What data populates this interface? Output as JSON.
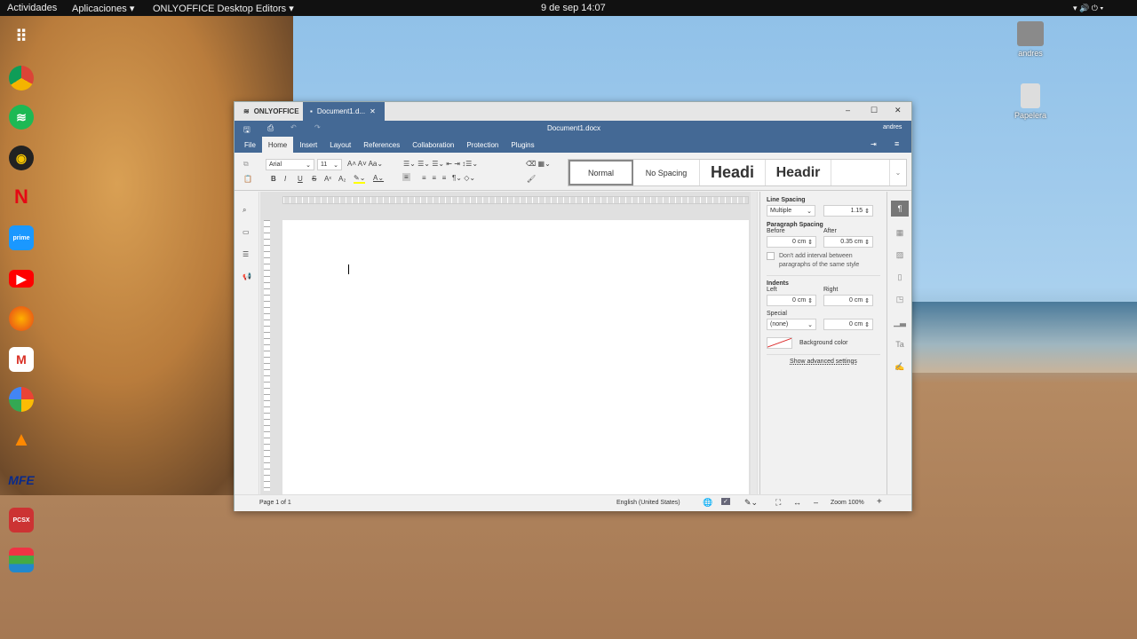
{
  "topbar": {
    "activities": "Actividades",
    "applications": "Aplicaciones ▾",
    "app": "ONLYOFFICE Desktop Editors ▾",
    "clock": "9 de sep  14:07",
    "tray": "▾ 🔊 ⏻ ▾"
  },
  "desktop": {
    "home": "andres",
    "trash": "Papelera"
  },
  "dock": [
    "chrome",
    "spotify",
    "rhythmbox",
    "netflix",
    "prime-video",
    "youtube",
    "firefox",
    "gmail",
    "photos",
    "vlc",
    "mfe",
    "pcsx",
    "onlyoffice"
  ],
  "window": {
    "brand": "ONLYOFFICE",
    "tab": "Document1.d...",
    "title": "Document1.docx",
    "user": "andres",
    "menu": [
      "File",
      "Home",
      "Insert",
      "Layout",
      "References",
      "Collaboration",
      "Protection",
      "Plugins"
    ],
    "font": "Arial",
    "size": "11",
    "styles": [
      "Normal",
      "No Spacing",
      "Headi",
      "Headir"
    ],
    "panel": {
      "line_spacing": "Line Spacing",
      "ls_type": "Multiple",
      "ls_value": "1.15",
      "para_spacing": "Paragraph Spacing",
      "before": "Before",
      "after": "After",
      "before_val": "0 cm",
      "after_val": "0.35 cm",
      "no_interval": "Don't add interval between paragraphs of the same style",
      "indents": "Indents",
      "left": "Left",
      "right": "Right",
      "left_val": "0 cm",
      "right_val": "0 cm",
      "special": "Special",
      "special_val": "(none)",
      "special_amt": "0 cm",
      "bg": "Background color",
      "advanced": "Show advanced settings"
    },
    "status": {
      "page": "Page 1 of 1",
      "lang": "English (United States)",
      "zoom": "Zoom 100%"
    }
  },
  "colors": {
    "accent": "#446995"
  }
}
